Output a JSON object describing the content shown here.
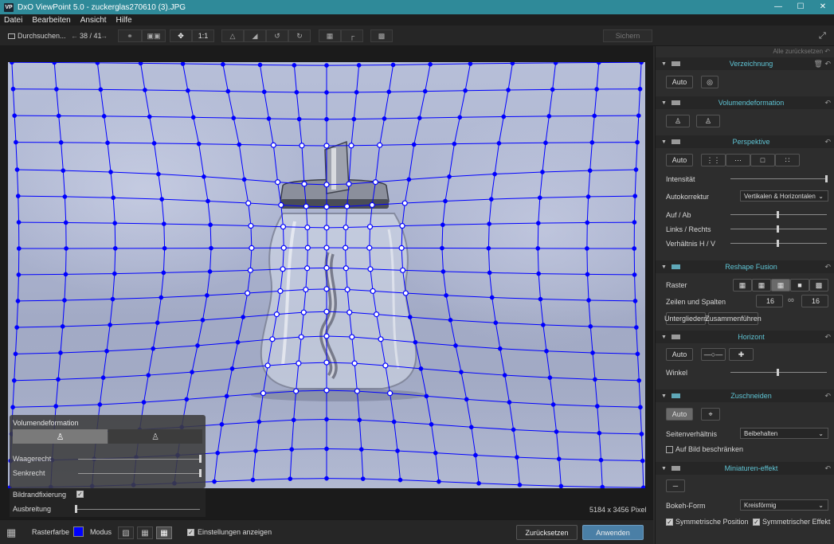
{
  "window": {
    "title": "DxO ViewPoint 5.0 - zuckerglas270610 (3).JPG",
    "app_icon": "VP"
  },
  "menu": [
    "Datei",
    "Bearbeiten",
    "Ansicht",
    "Hilfe"
  ],
  "toolbar": {
    "browse_label": "Durchsuchen...",
    "counter": "38 / 41",
    "zoom_label": "1:1",
    "save_label": "Sichern"
  },
  "viewer": {
    "pixel_info": "5184 x 3456 Pixel"
  },
  "volume_palette": {
    "title": "Volumendeformation",
    "slider1_label": "Waagerecht",
    "slider2_label": "Senkrecht",
    "fixation_label": "Bildrandfixierung",
    "spread_label": "Ausbreitung"
  },
  "bottombar": {
    "grid_color_label": "Rasterfarbe",
    "grid_color": "#0000ff",
    "mode_label": "Modus",
    "show_settings_label": "Einstellungen anzeigen",
    "reset_label": "Zurücksetzen",
    "apply_label": "Anwenden"
  },
  "panel": {
    "reset_all": "Alle zurücksetzen",
    "distortion": {
      "title": "Verzeichnung",
      "auto": "Auto"
    },
    "volume": {
      "title": "Volumendeformation"
    },
    "perspective": {
      "title": "Perspektive",
      "auto": "Auto",
      "intensity_label": "Intensität",
      "autocorrect_label": "Autokorrektur",
      "autocorrect_value": "Vertikalen & Horizontalen",
      "up_down_label": "Auf / Ab",
      "left_right_label": "Links / Rechts",
      "ratio_label": "Verhältnis H / V"
    },
    "reshape": {
      "title": "Reshape Fusion",
      "grid_label": "Raster",
      "rows_cols_label": "Zeilen und Spalten",
      "rows": "16",
      "cols": "16",
      "subdivide_label": "Untergliedern",
      "merge_label": "Zusammenführen"
    },
    "horizon": {
      "title": "Horizont",
      "auto": "Auto",
      "angle_label": "Winkel"
    },
    "crop": {
      "title": "Zuschneiden",
      "auto": "Auto",
      "aspect_label": "Seitenverhältnis",
      "aspect_value": "Beibehalten",
      "limit_label": "Auf Bild beschränken"
    },
    "miniature": {
      "title": "Miniaturen-effekt",
      "bokeh_label": "Bokeh-Form",
      "bokeh_value": "Kreisförmig",
      "sym_pos_label": "Symmetrische Position",
      "sym_eff_label": "Symmetrischer Effekt"
    }
  }
}
